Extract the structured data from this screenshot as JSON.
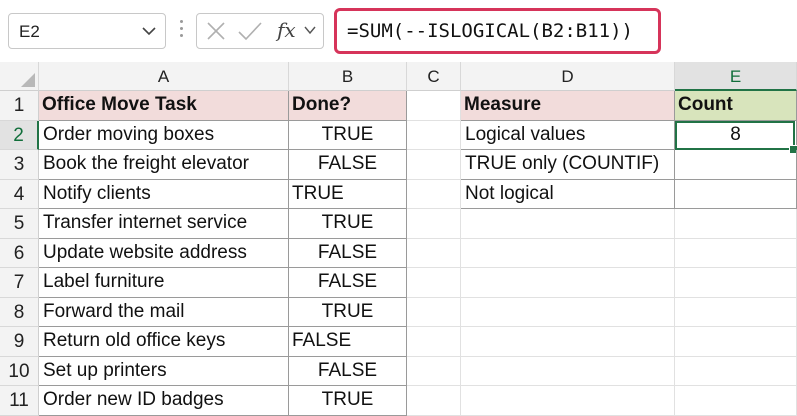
{
  "name_box": "E2",
  "formula": "=SUM(--ISLOGICAL(B2:B11))",
  "columns": [
    "A",
    "B",
    "C",
    "D",
    "E"
  ],
  "rows": [
    "1",
    "2",
    "3",
    "4",
    "5",
    "6",
    "7",
    "8",
    "9",
    "10",
    "11"
  ],
  "table1": {
    "header_task": "Office Move Task",
    "header_done": "Done?",
    "rows": [
      {
        "task": "Order moving boxes",
        "done": "TRUE"
      },
      {
        "task": "Book the freight elevator",
        "done": "FALSE"
      },
      {
        "task": "Notify clients",
        "done": "TRUE"
      },
      {
        "task": "Transfer internet service",
        "done": "TRUE"
      },
      {
        "task": "Update website address",
        "done": "FALSE"
      },
      {
        "task": "Label furniture",
        "done": "FALSE"
      },
      {
        "task": "Forward the mail",
        "done": "TRUE"
      },
      {
        "task": "Return old office keys",
        "done": "FALSE"
      },
      {
        "task": "Set up printers",
        "done": "FALSE"
      },
      {
        "task": "Order new ID badges",
        "done": "TRUE"
      }
    ]
  },
  "table2": {
    "header_measure": "Measure",
    "header_count": "Count",
    "rows": [
      {
        "measure": "Logical values",
        "count": "8"
      },
      {
        "measure": "TRUE only (COUNTIF)",
        "count": ""
      },
      {
        "measure": "Not logical",
        "count": ""
      }
    ]
  },
  "colors": {
    "accent": "#217346",
    "formula_border": "#d6345a",
    "header_pink": "#f2dcdb",
    "header_green": "#d8e4bc"
  }
}
